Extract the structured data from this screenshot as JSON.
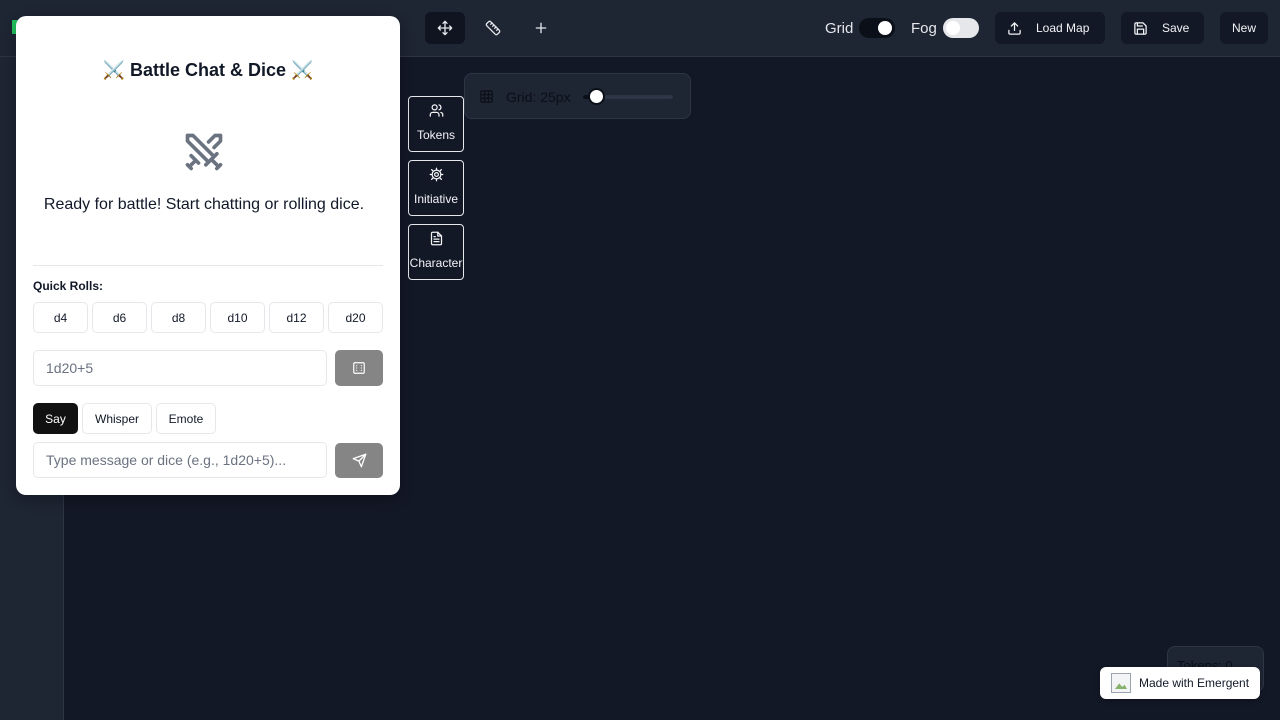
{
  "topbar": {
    "tools": [
      {
        "name": "move",
        "icon": "move-icon"
      },
      {
        "name": "measure",
        "icon": "ruler-icon"
      },
      {
        "name": "add",
        "icon": "plus-icon"
      }
    ],
    "grid_label": "Grid",
    "grid_enabled": true,
    "fog_label": "Fog",
    "fog_enabled": false,
    "load_map_label": "Load Map",
    "save_label": "Save",
    "new_label": "New"
  },
  "grid_panel": {
    "label": "Grid: 25px"
  },
  "side_tabs": [
    {
      "label": "Tokens",
      "icon": "users-icon"
    },
    {
      "label": "Initiative",
      "icon": "gear-icon"
    },
    {
      "label": "Character",
      "icon": "document-icon"
    }
  ],
  "chat": {
    "title": "⚔️ Battle Chat & Dice ⚔️",
    "empty_message": "Ready for battle! Start chatting or rolling dice.",
    "quick_rolls_label": "Quick Rolls:",
    "dice": [
      "d4",
      "d6",
      "d8",
      "d10",
      "d12",
      "d20"
    ],
    "dice_placeholder": "1d20+5",
    "modes": [
      "Say",
      "Whisper",
      "Emote"
    ],
    "active_mode": "Say",
    "message_placeholder": "Type message or dice (e.g., 1d20+5)..."
  },
  "token_counter": "Tokens: 0",
  "badge": "Made with Emergent",
  "colors": {
    "background": "#131827",
    "panel": "#1e2533",
    "accent": "#22c55e"
  }
}
